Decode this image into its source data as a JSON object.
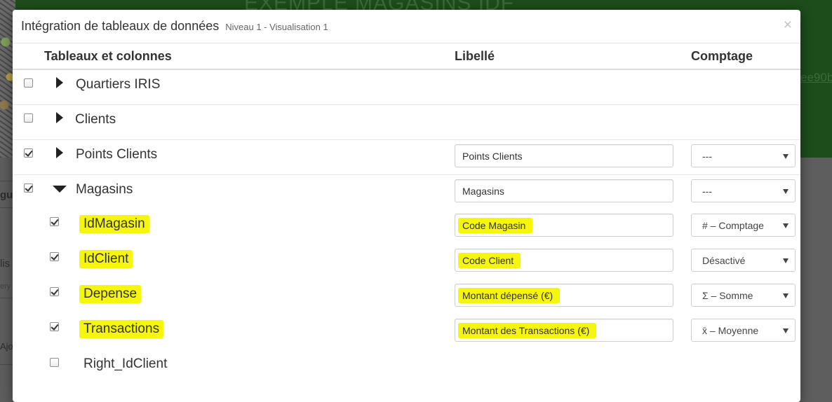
{
  "background": {
    "title": "EXEMPLE MAGASINS IDF",
    "link_fragment": "ee90b",
    "side_1": "gu",
    "side_2": "lis",
    "side_3": "ery",
    "side_4": "Ajo"
  },
  "modal": {
    "title": "Intégration de tableaux de données",
    "subtitle": "Niveau 1 - Visualisation 1",
    "close": "×"
  },
  "columns": {
    "tables": "Tableaux et colonnes",
    "libelle": "Libellé",
    "comptage": "Comptage"
  },
  "rows": [
    {
      "name": "Quartiers IRIS",
      "checked": false,
      "expanded": false
    },
    {
      "name": "Clients",
      "checked": false,
      "expanded": false
    },
    {
      "name": "Points Clients",
      "checked": true,
      "expanded": false,
      "label": "Points Clients",
      "count": "---"
    },
    {
      "name": "Magasins",
      "checked": true,
      "expanded": true,
      "label": "Magasins",
      "count": "---"
    },
    {
      "name": "IdMagasin",
      "checked": true,
      "highlighted": true,
      "label": "Code Magasin",
      "count": "# – Comptage"
    },
    {
      "name": "IdClient",
      "checked": true,
      "highlighted": true,
      "label": "Code Client",
      "count": "Désactivé"
    },
    {
      "name": "Depense",
      "checked": true,
      "highlighted": true,
      "label": "Montant dépensé (€)",
      "count": "Σ – Somme"
    },
    {
      "name": "Transactions",
      "checked": true,
      "highlighted": true,
      "label": "Montant des Transactions (€)",
      "count": "x̄ – Moyenne"
    },
    {
      "name": "Right_IdClient",
      "checked": false
    }
  ],
  "colors": {
    "highlight": "#f6f60b",
    "header_green": "#1d4d1a"
  }
}
